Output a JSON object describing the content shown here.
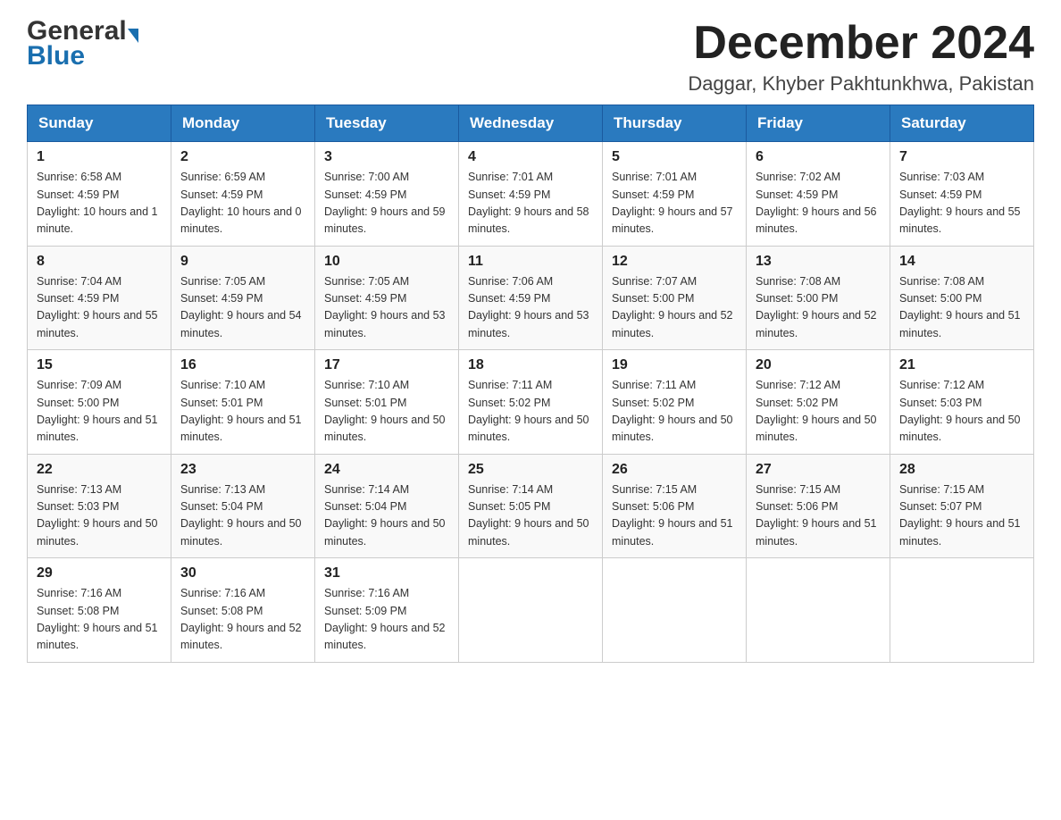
{
  "header": {
    "logo_general": "General",
    "logo_blue": "Blue",
    "month_title": "December 2024",
    "location": "Daggar, Khyber Pakhtunkhwa, Pakistan"
  },
  "weekdays": [
    "Sunday",
    "Monday",
    "Tuesday",
    "Wednesday",
    "Thursday",
    "Friday",
    "Saturday"
  ],
  "weeks": [
    [
      {
        "date": "1",
        "sunrise": "6:58 AM",
        "sunset": "4:59 PM",
        "daylight": "10 hours and 1 minute."
      },
      {
        "date": "2",
        "sunrise": "6:59 AM",
        "sunset": "4:59 PM",
        "daylight": "10 hours and 0 minutes."
      },
      {
        "date": "3",
        "sunrise": "7:00 AM",
        "sunset": "4:59 PM",
        "daylight": "9 hours and 59 minutes."
      },
      {
        "date": "4",
        "sunrise": "7:01 AM",
        "sunset": "4:59 PM",
        "daylight": "9 hours and 58 minutes."
      },
      {
        "date": "5",
        "sunrise": "7:01 AM",
        "sunset": "4:59 PM",
        "daylight": "9 hours and 57 minutes."
      },
      {
        "date": "6",
        "sunrise": "7:02 AM",
        "sunset": "4:59 PM",
        "daylight": "9 hours and 56 minutes."
      },
      {
        "date": "7",
        "sunrise": "7:03 AM",
        "sunset": "4:59 PM",
        "daylight": "9 hours and 55 minutes."
      }
    ],
    [
      {
        "date": "8",
        "sunrise": "7:04 AM",
        "sunset": "4:59 PM",
        "daylight": "9 hours and 55 minutes."
      },
      {
        "date": "9",
        "sunrise": "7:05 AM",
        "sunset": "4:59 PM",
        "daylight": "9 hours and 54 minutes."
      },
      {
        "date": "10",
        "sunrise": "7:05 AM",
        "sunset": "4:59 PM",
        "daylight": "9 hours and 53 minutes."
      },
      {
        "date": "11",
        "sunrise": "7:06 AM",
        "sunset": "4:59 PM",
        "daylight": "9 hours and 53 minutes."
      },
      {
        "date": "12",
        "sunrise": "7:07 AM",
        "sunset": "5:00 PM",
        "daylight": "9 hours and 52 minutes."
      },
      {
        "date": "13",
        "sunrise": "7:08 AM",
        "sunset": "5:00 PM",
        "daylight": "9 hours and 52 minutes."
      },
      {
        "date": "14",
        "sunrise": "7:08 AM",
        "sunset": "5:00 PM",
        "daylight": "9 hours and 51 minutes."
      }
    ],
    [
      {
        "date": "15",
        "sunrise": "7:09 AM",
        "sunset": "5:00 PM",
        "daylight": "9 hours and 51 minutes."
      },
      {
        "date": "16",
        "sunrise": "7:10 AM",
        "sunset": "5:01 PM",
        "daylight": "9 hours and 51 minutes."
      },
      {
        "date": "17",
        "sunrise": "7:10 AM",
        "sunset": "5:01 PM",
        "daylight": "9 hours and 50 minutes."
      },
      {
        "date": "18",
        "sunrise": "7:11 AM",
        "sunset": "5:02 PM",
        "daylight": "9 hours and 50 minutes."
      },
      {
        "date": "19",
        "sunrise": "7:11 AM",
        "sunset": "5:02 PM",
        "daylight": "9 hours and 50 minutes."
      },
      {
        "date": "20",
        "sunrise": "7:12 AM",
        "sunset": "5:02 PM",
        "daylight": "9 hours and 50 minutes."
      },
      {
        "date": "21",
        "sunrise": "7:12 AM",
        "sunset": "5:03 PM",
        "daylight": "9 hours and 50 minutes."
      }
    ],
    [
      {
        "date": "22",
        "sunrise": "7:13 AM",
        "sunset": "5:03 PM",
        "daylight": "9 hours and 50 minutes."
      },
      {
        "date": "23",
        "sunrise": "7:13 AM",
        "sunset": "5:04 PM",
        "daylight": "9 hours and 50 minutes."
      },
      {
        "date": "24",
        "sunrise": "7:14 AM",
        "sunset": "5:04 PM",
        "daylight": "9 hours and 50 minutes."
      },
      {
        "date": "25",
        "sunrise": "7:14 AM",
        "sunset": "5:05 PM",
        "daylight": "9 hours and 50 minutes."
      },
      {
        "date": "26",
        "sunrise": "7:15 AM",
        "sunset": "5:06 PM",
        "daylight": "9 hours and 51 minutes."
      },
      {
        "date": "27",
        "sunrise": "7:15 AM",
        "sunset": "5:06 PM",
        "daylight": "9 hours and 51 minutes."
      },
      {
        "date": "28",
        "sunrise": "7:15 AM",
        "sunset": "5:07 PM",
        "daylight": "9 hours and 51 minutes."
      }
    ],
    [
      {
        "date": "29",
        "sunrise": "7:16 AM",
        "sunset": "5:08 PM",
        "daylight": "9 hours and 51 minutes."
      },
      {
        "date": "30",
        "sunrise": "7:16 AM",
        "sunset": "5:08 PM",
        "daylight": "9 hours and 52 minutes."
      },
      {
        "date": "31",
        "sunrise": "7:16 AM",
        "sunset": "5:09 PM",
        "daylight": "9 hours and 52 minutes."
      },
      null,
      null,
      null,
      null
    ]
  ]
}
